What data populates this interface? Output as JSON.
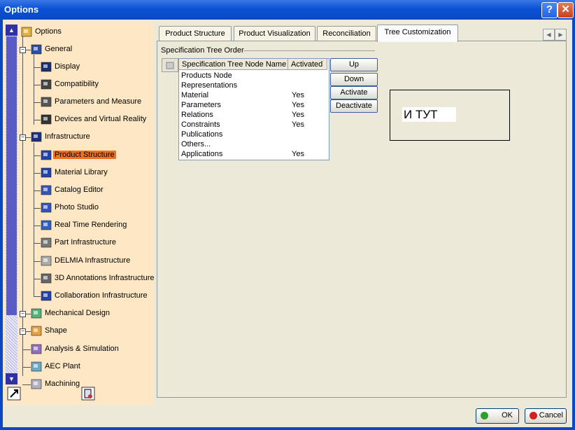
{
  "window": {
    "title": "Options",
    "help_glyph": "?",
    "close_glyph": "✕"
  },
  "tree": {
    "items": [
      {
        "label": "Options",
        "icon": "options-icon"
      },
      {
        "label": "General",
        "icon": "general-icon"
      },
      {
        "label": "Display",
        "icon": "display-icon"
      },
      {
        "label": "Compatibility",
        "icon": "compatibility-icon"
      },
      {
        "label": "Parameters and Measure",
        "icon": "parameters-icon"
      },
      {
        "label": "Devices and Virtual Reality",
        "icon": "devices-icon"
      },
      {
        "label": "Infrastructure",
        "icon": "infrastructure-icon"
      },
      {
        "label": "Product Structure",
        "icon": "product-structure-icon",
        "selected": true
      },
      {
        "label": "Material Library",
        "icon": "material-library-icon"
      },
      {
        "label": "Catalog Editor",
        "icon": "catalog-editor-icon"
      },
      {
        "label": "Photo Studio",
        "icon": "photo-studio-icon"
      },
      {
        "label": "Real Time Rendering",
        "icon": "rendering-icon"
      },
      {
        "label": "Part Infrastructure",
        "icon": "part-infrastructure-icon"
      },
      {
        "label": "DELMIA Infrastructure",
        "icon": "delmia-icon"
      },
      {
        "label": "3D Annotations Infrastructure",
        "icon": "annotations-icon"
      },
      {
        "label": "Collaboration Infrastructure",
        "icon": "collaboration-icon"
      },
      {
        "label": "Mechanical Design",
        "icon": "mechanical-design-icon"
      },
      {
        "label": "Shape",
        "icon": "shape-icon"
      },
      {
        "label": "Analysis & Simulation",
        "icon": "analysis-icon"
      },
      {
        "label": "AEC Plant",
        "icon": "aec-plant-icon"
      },
      {
        "label": "Machining",
        "icon": "machining-icon"
      }
    ]
  },
  "tabs": [
    {
      "label": "Product Structure"
    },
    {
      "label": "Product Visualization"
    },
    {
      "label": "Reconciliation"
    },
    {
      "label": "Tree Customization",
      "active": true
    }
  ],
  "panel": {
    "group_label": "Specification Tree Order",
    "columns": [
      "Specification Tree Node Name",
      "Activated"
    ],
    "rows": [
      {
        "name": "Products Node",
        "activated": ""
      },
      {
        "name": "Representations",
        "activated": ""
      },
      {
        "name": "Material",
        "activated": "Yes"
      },
      {
        "name": "Parameters",
        "activated": "Yes"
      },
      {
        "name": "Relations",
        "activated": "Yes"
      },
      {
        "name": "Constraints",
        "activated": "Yes"
      },
      {
        "name": "Publications",
        "activated": ""
      },
      {
        "name": "Others...",
        "activated": ""
      },
      {
        "name": "Applications",
        "activated": "Yes"
      }
    ],
    "buttons": {
      "up": "Up",
      "down": "Down",
      "activate": "Activate",
      "deactivate": "Deactivate"
    },
    "annotation_text": "И ТУТ"
  },
  "footer": {
    "ok": "OK",
    "cancel": "Cancel"
  },
  "colors": {
    "selection": "#f26e1f",
    "tree_bg": "#fde7c4",
    "titlebar": "#0a52d4"
  }
}
